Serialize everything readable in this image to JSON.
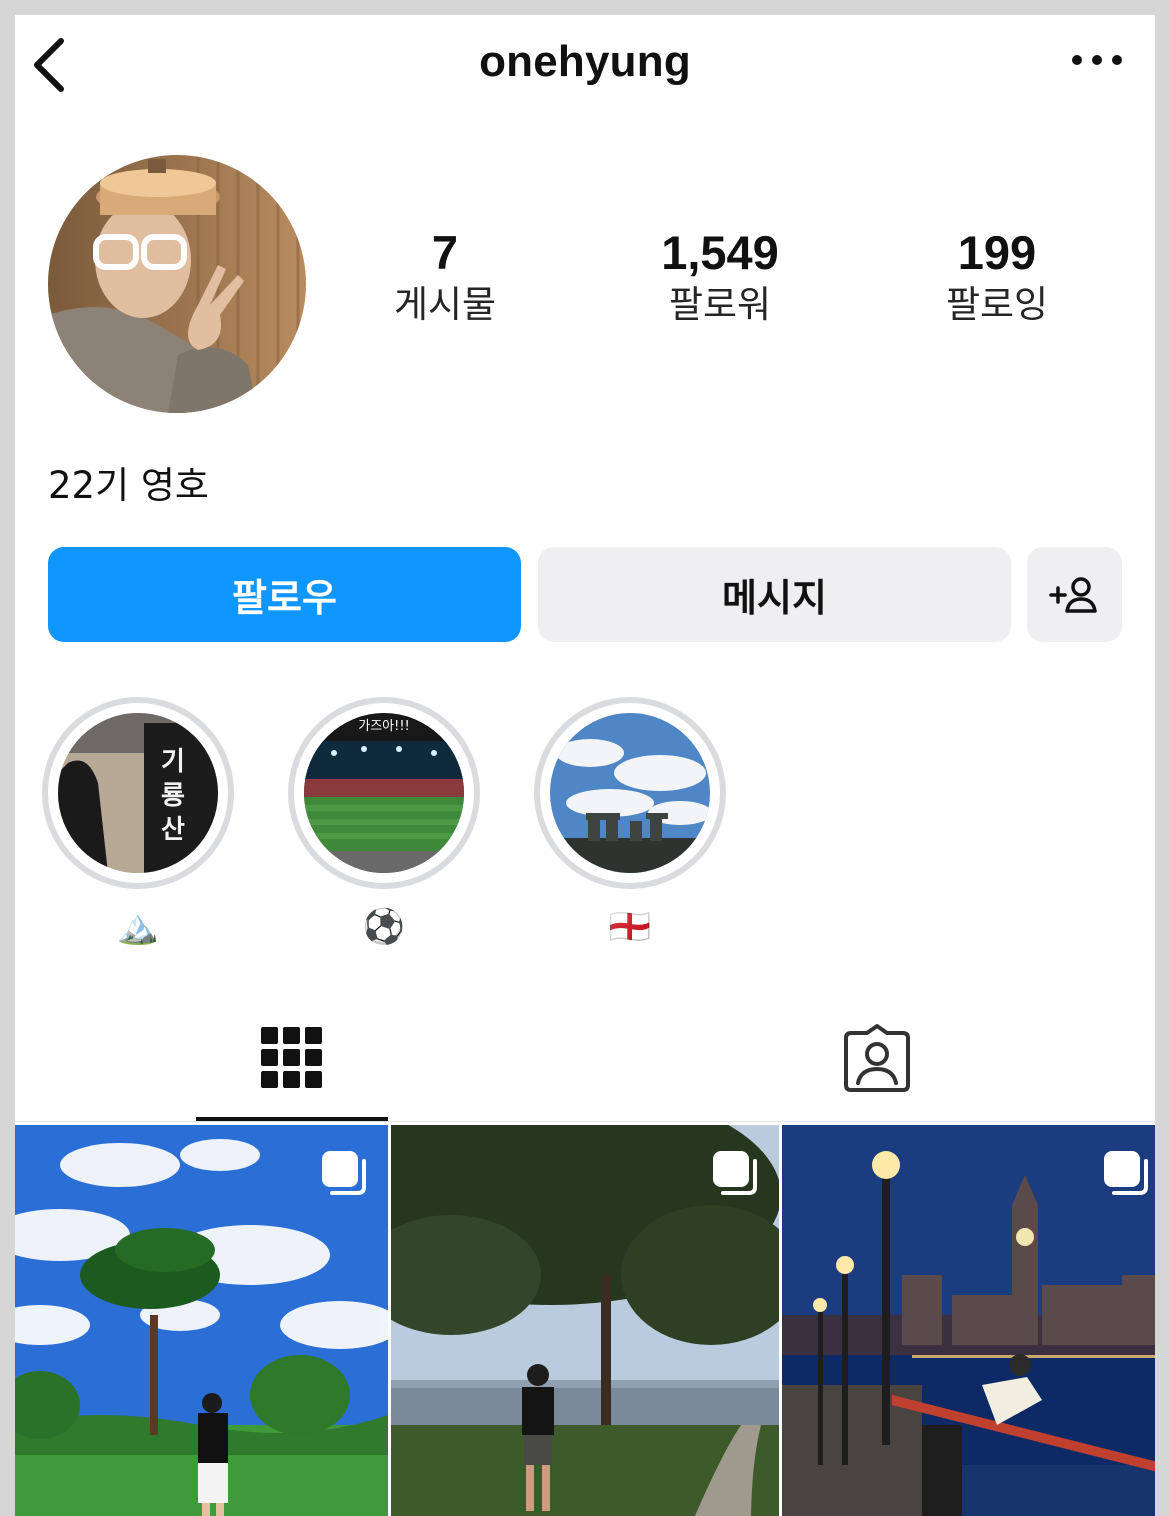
{
  "header": {
    "username": "onehyung",
    "back_icon": "chevron-left-icon",
    "more_icon": "ellipsis-icon"
  },
  "profile": {
    "avatar_alt": "profile photo",
    "stats": [
      {
        "value": "7",
        "label": "게시물"
      },
      {
        "value": "1,549",
        "label": "팔로워"
      },
      {
        "value": "199",
        "label": "팔로잉"
      }
    ],
    "bio": "22기 영호"
  },
  "actions": {
    "follow_label": "팔로우",
    "message_label": "메시지",
    "suggest_icon": "add-person-icon"
  },
  "highlights": [
    {
      "label": "🏔️",
      "cover": "mountain-sign",
      "cover_text": "기룡산"
    },
    {
      "label": "⚽",
      "cover": "stadium",
      "cover_text": "가즈아!!!"
    },
    {
      "label": "🏴󠁧󠁢󠁥󠁮󠁧󠁿",
      "cover": "stonehenge"
    }
  ],
  "tabs": [
    {
      "name": "grid",
      "icon": "grid-icon",
      "active": true
    },
    {
      "name": "tagged",
      "icon": "tagged-person-icon",
      "active": false
    }
  ],
  "posts": [
    {
      "scene": "golf course under blue sky with large pine tree",
      "multi": true
    },
    {
      "scene": "person standing by lake under trees",
      "multi": true
    },
    {
      "scene": "night riverside with lamp posts and Big Ben",
      "multi": true
    }
  ],
  "colors": {
    "accent": "#1096ff",
    "secondary_button": "#efeff1",
    "ring": "#d9dbdf"
  }
}
